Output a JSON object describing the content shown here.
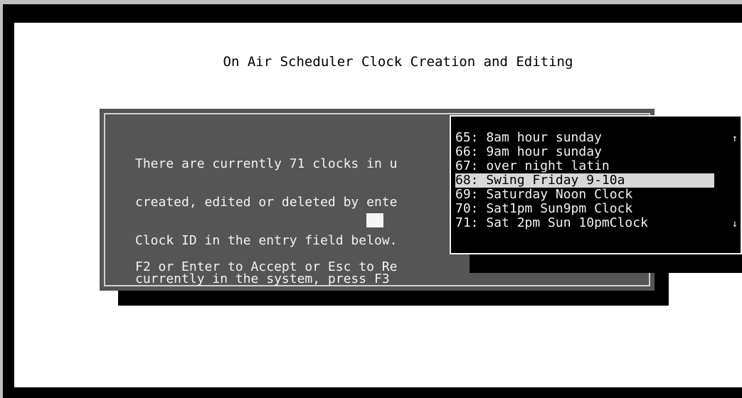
{
  "title": "On Air Scheduler Clock Creation and Editing",
  "dialog": {
    "lines": [
      "There are currently 71 clocks in u",
      "created, edited or deleted by ente",
      "Clock ID in the entry field below.",
      "currently in the system, press F3"
    ],
    "entry_value": "",
    "hint": "F2 or Enter to Accept or Esc to Re"
  },
  "clock_list": {
    "items": [
      "65: 8am hour sunday",
      "66: 9am hour sunday",
      "67: over night latin",
      "68: Swing Friday 9-10a",
      "69: Saturday Noon Clock",
      "70: Sat1pm Sun9pm Clock",
      "71: Sat 2pm Sun 10pmClock"
    ],
    "selected_index": 3,
    "scroll_up": "↑",
    "scroll_down": "↓"
  }
}
